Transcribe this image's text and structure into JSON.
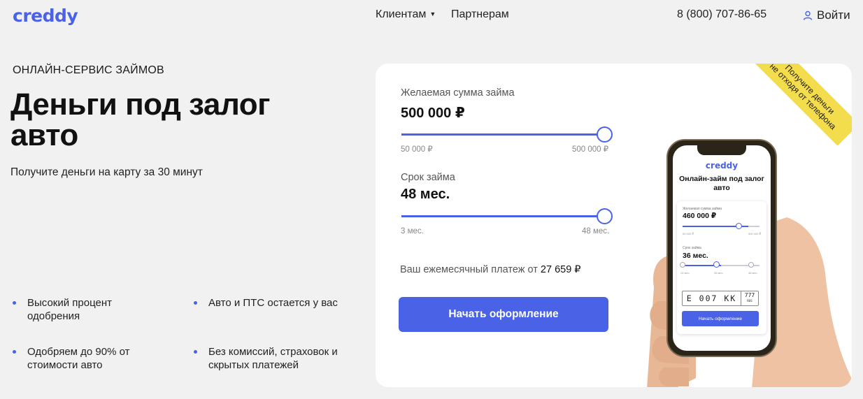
{
  "header": {
    "logo": "creddy",
    "nav": [
      {
        "label": "Клиентам"
      },
      {
        "label": "Партнерам"
      }
    ],
    "phone": "8 (800) 707-86-65",
    "login_label": "Войти"
  },
  "hero": {
    "kicker": "ОНЛАЙН-СЕРВИС ЗАЙМОВ",
    "headline": "Деньги под залог авто",
    "subtitle": "Получите деньги на карту за 30 минут",
    "features": [
      {
        "text": "Высокий процент одобрения"
      },
      {
        "text": "Авто и ПТС остается у вас"
      },
      {
        "text": "Одобряем до 90% от стоимости авто"
      },
      {
        "text": "Без комиссий, страховок и скрытых платежей"
      }
    ]
  },
  "calculator": {
    "amount": {
      "label": "Желаемая сумма займа",
      "value": "500 000 ₽",
      "min": "50 000 ₽",
      "max": "500 000 ₽",
      "level": 1.0
    },
    "term": {
      "label": "Срок займа",
      "value": "48 мес.",
      "min": "3 мес.",
      "max": "48 мес.",
      "level": 1.0
    },
    "payment_label": "Ваш ежемесячный платеж от",
    "payment_value": "27 659 ₽",
    "cta_label": "Начать оформление",
    "ribbon_line1": "Получите деньги",
    "ribbon_line2": "не отходя от телефона"
  },
  "phone_mock": {
    "logo": "creddy",
    "title": "Онлайн-займ под залог авто",
    "amount_label": "Желаемая сумма займа",
    "amount_value": "460 000 ₽",
    "amount_min": "50 000 ₽",
    "amount_max": "500 000 ₽",
    "term_label": "Срок займа",
    "term_value": "36 мес.",
    "term_options": [
      "24 мес.",
      "36 мес.",
      "48 мес."
    ],
    "plate_main": "Е 007 КК",
    "plate_region": "777",
    "plate_country": "RUS",
    "button_label": "Начать оформление"
  },
  "colors": {
    "accent": "#4a63e6",
    "ribbon": "#f3dd4d",
    "background": "#f1f1f2"
  }
}
